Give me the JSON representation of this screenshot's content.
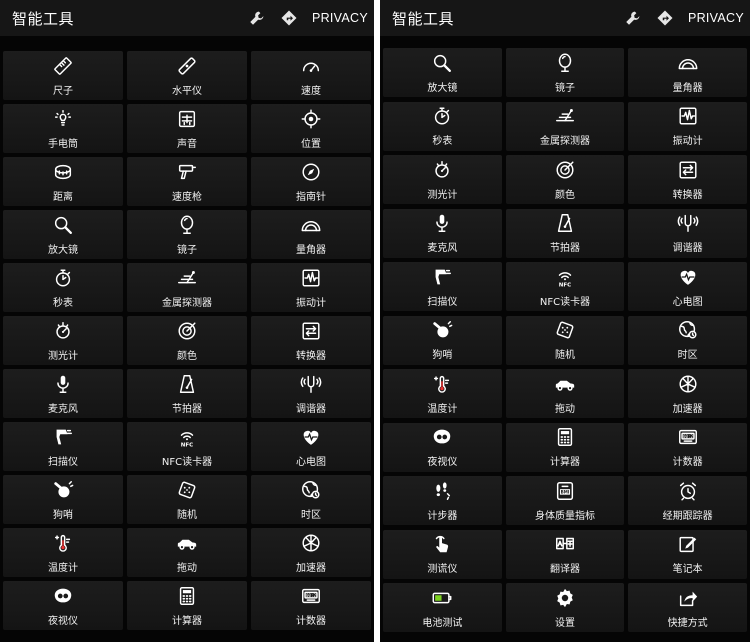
{
  "colors": {
    "background": "#050505",
    "appbar": "#161616",
    "tile": "#1a1a1a",
    "text": "#ffffff"
  },
  "left_panel": {
    "appbar": {
      "title": "智能工具",
      "privacy_label": "PRIVACY",
      "wrench_icon": "wrench-icon",
      "directions_icon": "directions-icon"
    },
    "tools": [
      {
        "label": "尺子",
        "icon": "ruler"
      },
      {
        "label": "水平仪",
        "icon": "level"
      },
      {
        "label": "速度",
        "icon": "speed"
      },
      {
        "label": "手电筒",
        "icon": "flashlight"
      },
      {
        "label": "声音",
        "icon": "sound"
      },
      {
        "label": "位置",
        "icon": "location"
      },
      {
        "label": "距离",
        "icon": "distance"
      },
      {
        "label": "速度枪",
        "icon": "speedgun"
      },
      {
        "label": "指南针",
        "icon": "compass"
      },
      {
        "label": "放大镜",
        "icon": "magnifier"
      },
      {
        "label": "镜子",
        "icon": "mirror"
      },
      {
        "label": "量角器",
        "icon": "protractor"
      },
      {
        "label": "秒表",
        "icon": "stopwatch"
      },
      {
        "label": "金属探测器",
        "icon": "metal"
      },
      {
        "label": "振动计",
        "icon": "vibration"
      },
      {
        "label": "测光计",
        "icon": "lightmeter"
      },
      {
        "label": "颜色",
        "icon": "color"
      },
      {
        "label": "转换器",
        "icon": "converter"
      },
      {
        "label": "麦克风",
        "icon": "mic"
      },
      {
        "label": "节拍器",
        "icon": "metronome"
      },
      {
        "label": "调谐器",
        "icon": "tuner"
      },
      {
        "label": "扫描仪",
        "icon": "scanner"
      },
      {
        "label": "NFC读卡器",
        "icon": "nfc"
      },
      {
        "label": "心电图",
        "icon": "heart"
      },
      {
        "label": "狗哨",
        "icon": "whistle"
      },
      {
        "label": "随机",
        "icon": "dice"
      },
      {
        "label": "时区",
        "icon": "globe"
      },
      {
        "label": "温度计",
        "icon": "thermo"
      },
      {
        "label": "拖动",
        "icon": "car"
      },
      {
        "label": "加速器",
        "icon": "accel"
      },
      {
        "label": "夜视仪",
        "icon": "night"
      },
      {
        "label": "计算器",
        "icon": "calc"
      },
      {
        "label": "计数器",
        "icon": "counter"
      }
    ]
  },
  "right_panel": {
    "appbar": {
      "title": "智能工具",
      "privacy_label": "PRIVACY",
      "wrench_icon": "wrench-icon",
      "directions_icon": "directions-icon"
    },
    "tools": [
      {
        "label": "放大镜",
        "icon": "magnifier"
      },
      {
        "label": "镜子",
        "icon": "mirror"
      },
      {
        "label": "量角器",
        "icon": "protractor"
      },
      {
        "label": "秒表",
        "icon": "stopwatch"
      },
      {
        "label": "金属探测器",
        "icon": "metal"
      },
      {
        "label": "振动计",
        "icon": "vibration"
      },
      {
        "label": "测光计",
        "icon": "lightmeter"
      },
      {
        "label": "颜色",
        "icon": "color"
      },
      {
        "label": "转换器",
        "icon": "converter"
      },
      {
        "label": "麦克风",
        "icon": "mic"
      },
      {
        "label": "节拍器",
        "icon": "metronome"
      },
      {
        "label": "调谐器",
        "icon": "tuner"
      },
      {
        "label": "扫描仪",
        "icon": "scanner"
      },
      {
        "label": "NFC读卡器",
        "icon": "nfc"
      },
      {
        "label": "心电图",
        "icon": "heart"
      },
      {
        "label": "狗哨",
        "icon": "whistle"
      },
      {
        "label": "随机",
        "icon": "dice"
      },
      {
        "label": "时区",
        "icon": "globe"
      },
      {
        "label": "温度计",
        "icon": "thermo"
      },
      {
        "label": "拖动",
        "icon": "car"
      },
      {
        "label": "加速器",
        "icon": "accel"
      },
      {
        "label": "夜视仪",
        "icon": "night"
      },
      {
        "label": "计算器",
        "icon": "calc"
      },
      {
        "label": "计数器",
        "icon": "counter"
      },
      {
        "label": "计步器",
        "icon": "steps"
      },
      {
        "label": "身体质量指标",
        "icon": "bmi"
      },
      {
        "label": "经期跟踪器",
        "icon": "alarm"
      },
      {
        "label": "测谎仪",
        "icon": "touch"
      },
      {
        "label": "翻译器",
        "icon": "translate"
      },
      {
        "label": "笔记本",
        "icon": "notebook"
      },
      {
        "label": "电池测试",
        "icon": "battery"
      },
      {
        "label": "设置",
        "icon": "settings"
      },
      {
        "label": "快捷方式",
        "icon": "share"
      }
    ]
  }
}
